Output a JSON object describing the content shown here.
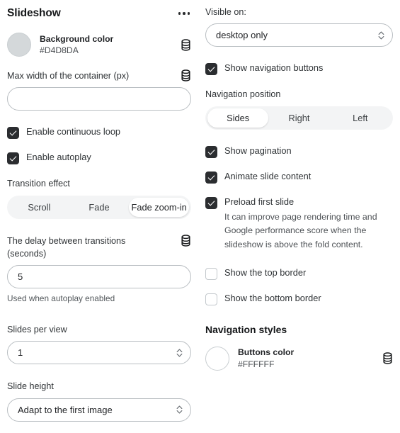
{
  "header": {
    "title": "Slideshow",
    "menu_icon": "kebab-menu-icon"
  },
  "left": {
    "background_color": {
      "name": "Background color",
      "value": "#D4D8DA",
      "swatch_hex": "#D4D8DA"
    },
    "max_width": {
      "label": "Max width of the container (px)",
      "value": "",
      "placeholder": ""
    },
    "continuous_loop": {
      "label": "Enable continuous loop",
      "checked": true
    },
    "autoplay": {
      "label": "Enable autoplay",
      "checked": true
    },
    "transition_effect": {
      "label": "Transition effect",
      "options": [
        "Scroll",
        "Fade",
        "Fade zoom-in"
      ],
      "selected": "Fade zoom-in"
    },
    "delay": {
      "label": "The delay between transitions (seconds)",
      "value": "5",
      "hint": "Used when autoplay enabled"
    },
    "slides_per_view": {
      "label": "Slides per view",
      "value": "1"
    },
    "slide_height": {
      "label": "Slide height",
      "value": "Adapt to the first image"
    }
  },
  "right": {
    "visible_on": {
      "label": "Visible on:",
      "value": "desktop only"
    },
    "show_nav_buttons": {
      "label": "Show navigation buttons",
      "checked": true
    },
    "nav_position": {
      "label": "Navigation position",
      "options": [
        "Sides",
        "Right",
        "Left"
      ],
      "selected": "Sides"
    },
    "show_pagination": {
      "label": "Show pagination",
      "checked": true
    },
    "animate_slide_content": {
      "label": "Animate slide content",
      "checked": true
    },
    "preload_first_slide": {
      "label": "Preload first slide",
      "checked": true,
      "description": "It can improve page rendering time and Google performance score when the slideshow is above the fold content."
    },
    "show_top_border": {
      "label": "Show the top border",
      "checked": false
    },
    "show_bottom_border": {
      "label": "Show the bottom border",
      "checked": false
    },
    "nav_styles_heading": "Navigation styles",
    "buttons_color": {
      "name": "Buttons color",
      "value": "#FFFFFF",
      "swatch_hex": "#FFFFFF"
    }
  },
  "icons": {
    "db": "database-icon",
    "stepper": "stepper-chevrons-icon"
  }
}
